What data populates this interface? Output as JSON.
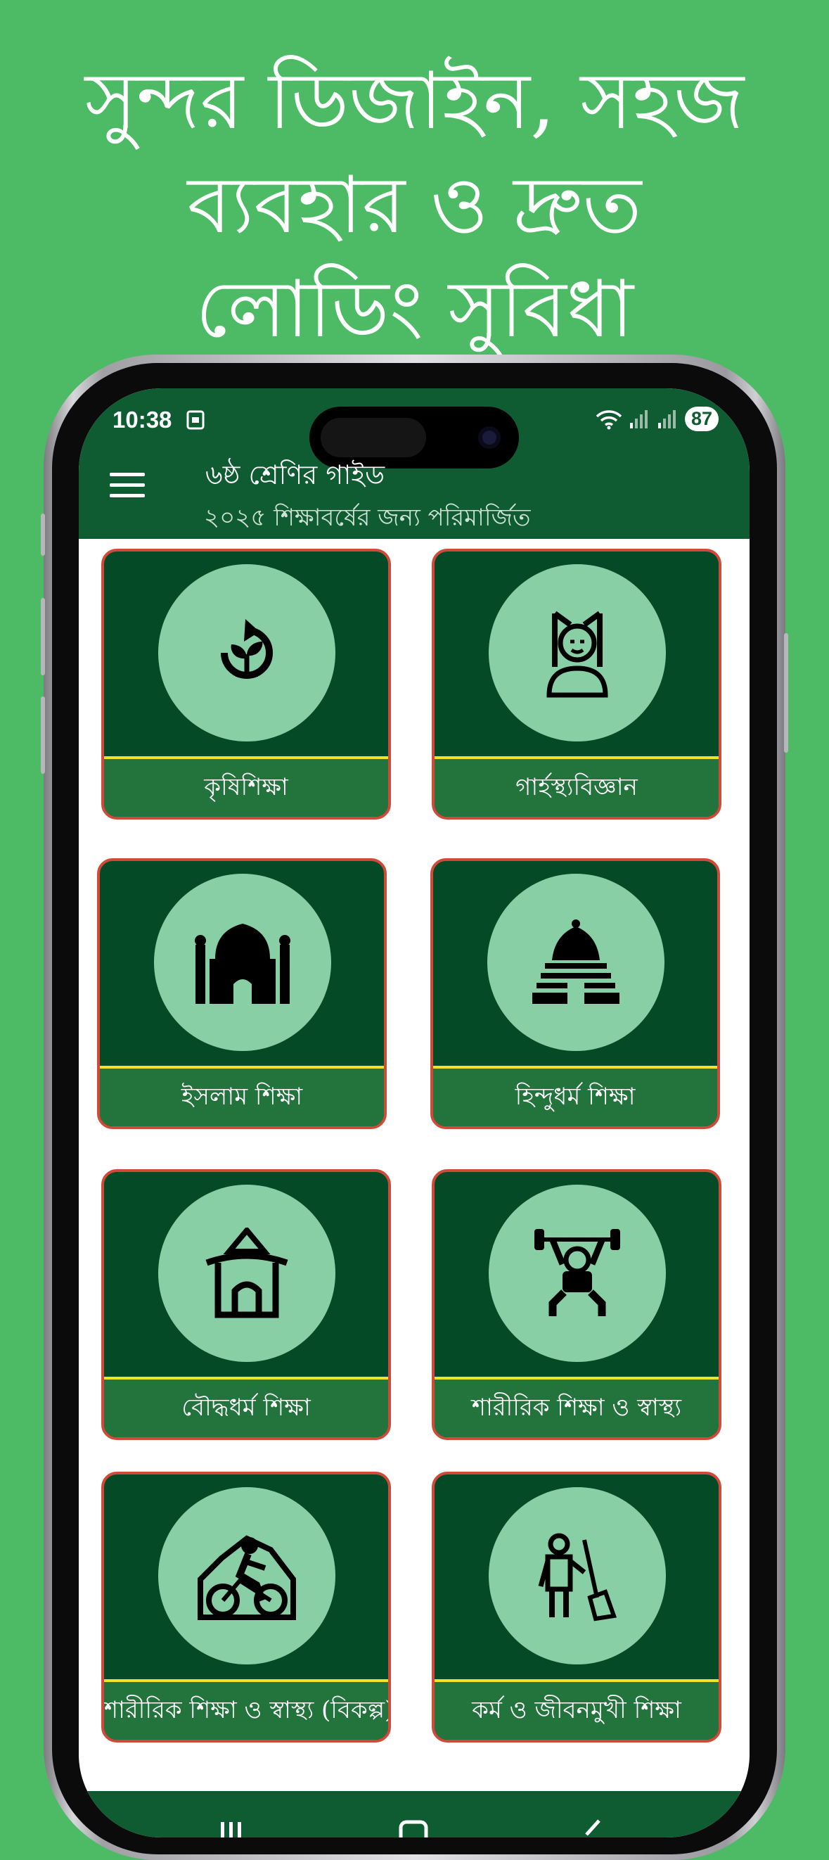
{
  "promo": {
    "line1": "সুন্দর ডিজাইন, সহজ",
    "line2": "ব্যবহার ও দ্রুত",
    "line3": "লোডিং সুবিধা"
  },
  "status_bar": {
    "time": "10:38",
    "battery": "87"
  },
  "app_bar": {
    "title": "৬ষ্ঠ শ্রেণির গাইড",
    "subtitle": "২০২৫ শিক্ষাবর্ষের জন্য পরিমার্জিত"
  },
  "subjects": [
    {
      "label": "কৃষিশিক্ষা",
      "icon": "sprout-cycle-icon"
    },
    {
      "label": "গার্হস্থ্যবিজ্ঞান",
      "icon": "woman-portrait-icon"
    },
    {
      "label": "ইসলাম শিক্ষা",
      "icon": "mosque-icon"
    },
    {
      "label": "হিন্দুধর্ম শিক্ষা",
      "icon": "hindu-temple-icon"
    },
    {
      "label": "বৌদ্ধধর্ম শিক্ষা",
      "icon": "pagoda-icon"
    },
    {
      "label": "শারীরিক শিক্ষা ও স্বাস্থ্য",
      "icon": "weightlifter-icon"
    },
    {
      "label": "শারীরিক শিক্ষা ও স্বাস্থ্য (বিকল্প)",
      "icon": "cyclist-icon"
    },
    {
      "label": "কর্ম ও জীবনমুখী শিক্ষা",
      "icon": "cleaner-worker-icon"
    }
  ],
  "colors": {
    "background": "#4dbb65",
    "app_bar": "#0f5c33",
    "card": "#054a27",
    "card_border": "#cf4a38",
    "icon_circle": "#88cfa6",
    "label_bar": "#22743c",
    "label_divider": "#f0e32a"
  }
}
